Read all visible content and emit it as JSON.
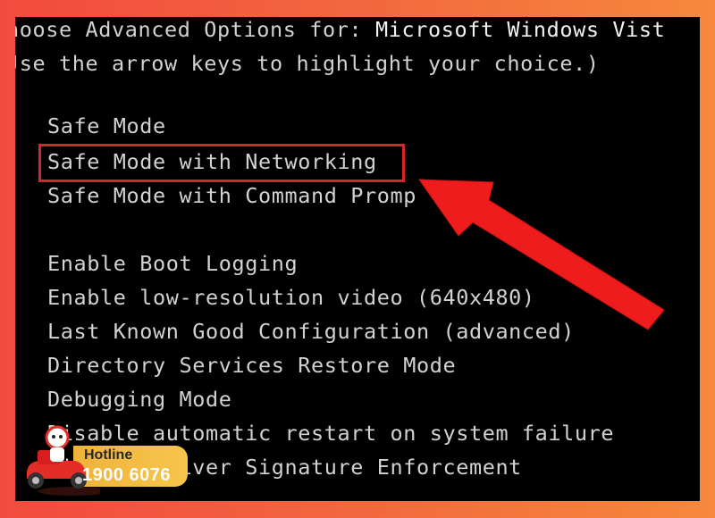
{
  "screen": {
    "header": {
      "line1_prefix": "hoose Advanced Options for: ",
      "line1_os": "Microsoft Windows Vist",
      "line2": "Jse the arrow keys to highlight your choice.)"
    },
    "options_group1": [
      "Safe Mode",
      "Safe Mode with Networking",
      "Safe Mode with Command Promp"
    ],
    "options_group2": [
      "Enable Boot Logging",
      "Enable low-resolution video (640x480)",
      "Last Known Good Configuration (advanced)",
      "Directory Services Restore Mode",
      "Debugging Mode",
      "Disable automatic restart on system failure",
      "Disable Driver Signature Enforcement"
    ],
    "highlighted_option": "Safe Mode with Networking"
  },
  "annotation": {
    "box_color": "#d62626",
    "arrow_color": "#ee1c1c",
    "arrow_icon": "red-arrow-icon"
  },
  "hotline": {
    "label": "Hotline",
    "number": "1900 6076",
    "mascot_icon": "delivery-scooter-mascot-icon"
  },
  "colors": {
    "frame_left": "#f24a3f",
    "frame_right": "#f6893c",
    "screen_bg": "#000000",
    "text": "#d2d2d2"
  }
}
